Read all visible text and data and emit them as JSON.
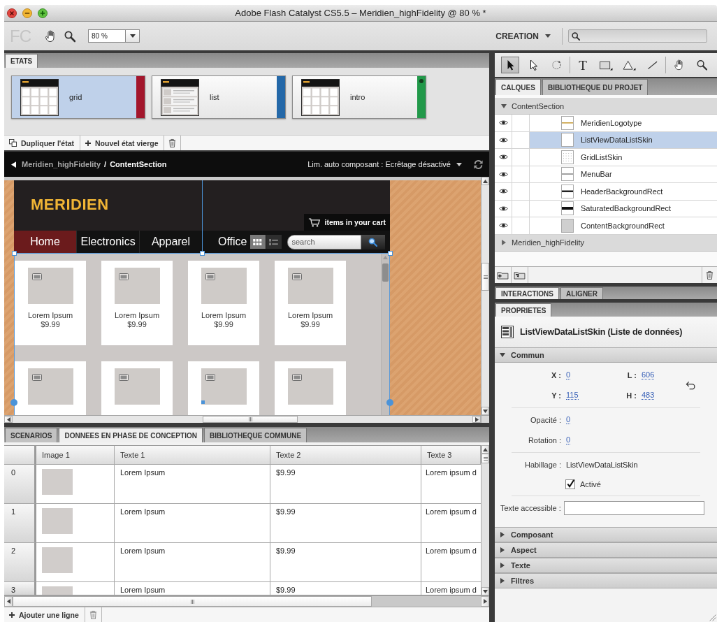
{
  "window": {
    "title": "Adobe Flash Catalyst CS5.5 – Meridien_highFidelity @ 80 % *"
  },
  "toolbar": {
    "logo": "FC",
    "zoom": "80 %",
    "workspace": "CREATION"
  },
  "states_panel": {
    "tab": "ETATS",
    "states": [
      {
        "name": "grid",
        "kind": "grid",
        "selected": true,
        "color": "#a3162c",
        "marker": false
      },
      {
        "name": "list",
        "kind": "list",
        "selected": false,
        "color": "#2468a8",
        "marker": false
      },
      {
        "name": "intro",
        "kind": "grid",
        "selected": false,
        "color": "#22994a",
        "marker": true
      }
    ],
    "actions": [
      "Dupliquer l'état",
      "Nouvel état vierge"
    ]
  },
  "breadcrumb": {
    "path": [
      "Meridien_highFidelity",
      "ContentSection"
    ],
    "separator": "/",
    "clipping": "Lim. auto composant : Ecrêtage désactivé"
  },
  "artboard": {
    "logo": "MERIDIEN",
    "cart": "items in your cart",
    "nav": [
      {
        "label": "Home",
        "selected": true
      },
      {
        "label": "Electronics",
        "selected": false
      },
      {
        "label": "Apparel",
        "selected": false
      },
      {
        "label": "Office",
        "selected": false
      }
    ],
    "views": [
      {
        "kind": "grid",
        "selected": true
      },
      {
        "kind": "list",
        "selected": false
      }
    ],
    "search": {
      "placeholder": "search"
    },
    "products": [
      {
        "kind": "full",
        "name": "Lorem Ipsum",
        "price": "$9.99"
      },
      {
        "kind": "full",
        "name": "Lorem Ipsum",
        "price": "$9.99"
      },
      {
        "kind": "full",
        "name": "Lorem Ipsum",
        "price": "$9.99"
      },
      {
        "kind": "full",
        "name": "Lorem Ipsum",
        "price": "$9.99"
      },
      {
        "kind": "cropped"
      },
      {
        "kind": "cropped"
      },
      {
        "kind": "cropped"
      },
      {
        "kind": "cropped"
      }
    ]
  },
  "bottom_panel": {
    "tabs": [
      {
        "label": "SCENARIOS",
        "selected": false
      },
      {
        "label": "DONNEES EN PHASE DE CONCEPTION",
        "selected": true
      },
      {
        "label": "BIBLIOTHEQUE COMMUNE",
        "selected": false
      }
    ],
    "table": {
      "columns": [
        "Image 1",
        "Texte 1",
        "Texte 2",
        "Texte 3"
      ],
      "rows": [
        {
          "index": "0",
          "text_1": "Lorem Ipsum",
          "text_2": "$9.99",
          "text_3": "Lorem ipsum d"
        },
        {
          "index": "1",
          "text_1": "Lorem Ipsum",
          "text_2": "$9.99",
          "text_3": "Lorem ipsum d"
        },
        {
          "index": "2",
          "text_1": "Lorem Ipsum",
          "text_2": "$9.99",
          "text_3": "Lorem ipsum d"
        },
        {
          "index": "3",
          "text_1": "Lorem Ipsum",
          "text_2": "$9.99",
          "text_3": "Lorem ipsum d"
        }
      ]
    },
    "add_row": "Ajouter une ligne"
  },
  "tools": [
    [
      {
        "kind": "select",
        "selected": true
      },
      {
        "kind": "direct",
        "selected": false
      },
      {
        "kind": "transform",
        "selected": false
      }
    ],
    [
      {
        "kind": "text",
        "label": "T",
        "selected": false
      },
      {
        "kind": "rectangle",
        "selected": false
      },
      {
        "kind": "triangle",
        "selected": false
      },
      {
        "kind": "line",
        "selected": false
      }
    ],
    [
      {
        "kind": "hand",
        "selected": false
      },
      {
        "kind": "zoom",
        "selected": false
      }
    ]
  ],
  "layers_panel": {
    "tabs": [
      {
        "label": "CALQUES",
        "selected": true
      },
      {
        "label": "BIBLIOTHEQUE DU PROJET",
        "selected": false
      }
    ],
    "tree": [
      {
        "name": "ContentSection",
        "expanded": true,
        "children": [
          {
            "name": "MeridienLogotype",
            "kind": "logotype",
            "visible": true,
            "selected": false
          },
          {
            "name": "ListViewDataListSkin",
            "kind": "blank",
            "visible": true,
            "selected": true
          },
          {
            "name": "GridListSkin",
            "kind": "grid",
            "visible": true,
            "selected": false
          },
          {
            "name": "MenuBar",
            "kind": "thinbar",
            "visible": true,
            "selected": false
          },
          {
            "name": "HeaderBackgroundRect",
            "kind": "bar",
            "visible": true,
            "selected": false
          },
          {
            "name": "SaturatedBackgroundRect",
            "kind": "thickbar",
            "visible": true,
            "selected": false
          },
          {
            "name": "ContentBackgroundRect",
            "kind": "fill",
            "visible": true,
            "selected": false
          }
        ]
      },
      {
        "name": "Meridien_highFidelity",
        "expanded": false
      }
    ]
  },
  "properties_panel": {
    "tabs": [
      {
        "label": "INTERACTIONS",
        "selected": true
      },
      {
        "label": "ALIGNER",
        "selected": false
      }
    ],
    "tab": "PROPRIETES",
    "title": "ListViewDataListSkin (Liste de données)",
    "sections": [
      {
        "title": "Commun",
        "expanded": true,
        "fields": {
          "geometry": [
            {
              "label": "X :",
              "value": "0"
            },
            {
              "label": "L :",
              "value": "606"
            },
            {
              "label": "Y :",
              "value": "115"
            },
            {
              "label": "H :",
              "value": "483"
            }
          ],
          "opacity": {
            "label": "Opacité :",
            "value": "0"
          },
          "rotation": {
            "label": "Rotation :",
            "value": "0"
          },
          "skin": {
            "label": "Habillage :",
            "value": "ListViewDataListSkin"
          },
          "enabled": {
            "label": "Activé",
            "checked": true
          },
          "accessible_text": {
            "label": "Texte accessible :"
          }
        }
      },
      {
        "title": "Composant",
        "expanded": false
      },
      {
        "title": "Aspect",
        "expanded": false
      },
      {
        "title": "Texte",
        "expanded": false
      },
      {
        "title": "Filtres",
        "expanded": false
      }
    ]
  }
}
